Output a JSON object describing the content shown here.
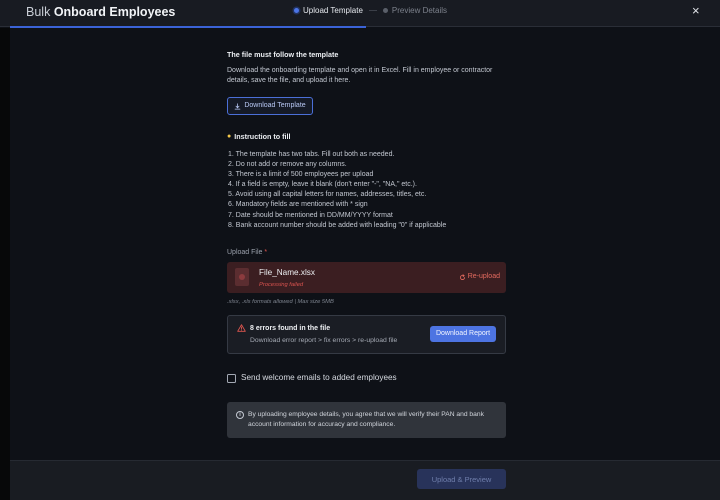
{
  "header": {
    "title_part1": "Bulk",
    "title_part2": "Onboard Employees",
    "steps": [
      {
        "label": "Upload Template",
        "active": true
      },
      {
        "label": "Preview Details",
        "active": false
      }
    ],
    "close_icon": "×"
  },
  "template_section": {
    "title": "The file must follow the template",
    "description": "Download the onboarding template and open it in Excel. Fill in employee or contractor details, save the file, and upload it here.",
    "download_label": "Download Template",
    "download_icon": "download-icon"
  },
  "instructions": {
    "title": "Instruction to fill",
    "items": [
      "1. The template has two tabs. Fill out both as needed.",
      "2. Do not add or remove any columns.",
      "3. There is a limit of 500 employees per upload",
      "4. If a field is empty, leave it blank (don't enter \"-\", \"NA,\" etc.).",
      "5. Avoid using all capital letters for names, addresses, titles, etc.",
      "6. Mandatory fields are mentioned with * sign",
      "7. Date should be mentioned in DD/MM/YYYY format",
      "8. Bank account number should be added with leading \"0\" if applicable"
    ]
  },
  "upload": {
    "label": "Upload File",
    "required_mark": "*",
    "file_name": "File_Name.xlsx",
    "status": "Processing failed",
    "reupload_label": "Re-upload",
    "formats_note": ".xlsx, .xls formats allowed | Max size 5MB"
  },
  "errors": {
    "title": "8 errors found in the file",
    "description": "Download error report > fix errors > re-upload file",
    "report_label": "Download Report"
  },
  "welcome_email": {
    "label": "Send welcome emails to added employees",
    "checked": false
  },
  "note": {
    "text": "By uploading employee details, you agree that we will verify their PAN and bank account information for accuracy and compliance."
  },
  "footer": {
    "primary_label": "Upload & Preview"
  },
  "colors": {
    "accent": "#4d74e2",
    "error": "#d9534f",
    "background": "#0e1117"
  }
}
